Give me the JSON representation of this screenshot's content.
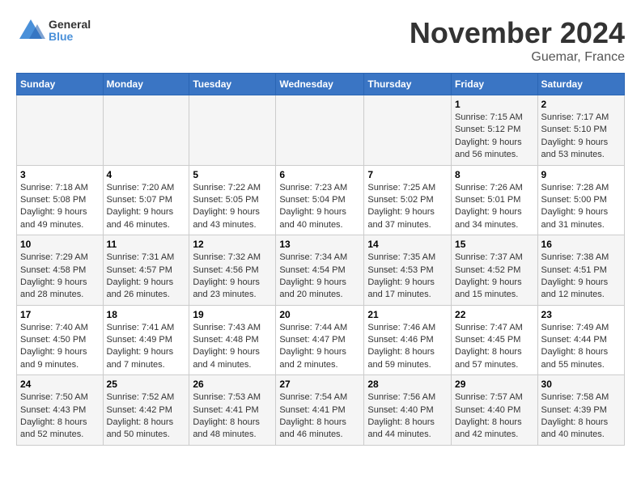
{
  "header": {
    "logo_general": "General",
    "logo_blue": "Blue",
    "month_title": "November 2024",
    "location": "Guemar, France"
  },
  "weekdays": [
    "Sunday",
    "Monday",
    "Tuesday",
    "Wednesday",
    "Thursday",
    "Friday",
    "Saturday"
  ],
  "weeks": [
    [
      {
        "day": "",
        "info": ""
      },
      {
        "day": "",
        "info": ""
      },
      {
        "day": "",
        "info": ""
      },
      {
        "day": "",
        "info": ""
      },
      {
        "day": "",
        "info": ""
      },
      {
        "day": "1",
        "info": "Sunrise: 7:15 AM\nSunset: 5:12 PM\nDaylight: 9 hours and 56 minutes."
      },
      {
        "day": "2",
        "info": "Sunrise: 7:17 AM\nSunset: 5:10 PM\nDaylight: 9 hours and 53 minutes."
      }
    ],
    [
      {
        "day": "3",
        "info": "Sunrise: 7:18 AM\nSunset: 5:08 PM\nDaylight: 9 hours and 49 minutes."
      },
      {
        "day": "4",
        "info": "Sunrise: 7:20 AM\nSunset: 5:07 PM\nDaylight: 9 hours and 46 minutes."
      },
      {
        "day": "5",
        "info": "Sunrise: 7:22 AM\nSunset: 5:05 PM\nDaylight: 9 hours and 43 minutes."
      },
      {
        "day": "6",
        "info": "Sunrise: 7:23 AM\nSunset: 5:04 PM\nDaylight: 9 hours and 40 minutes."
      },
      {
        "day": "7",
        "info": "Sunrise: 7:25 AM\nSunset: 5:02 PM\nDaylight: 9 hours and 37 minutes."
      },
      {
        "day": "8",
        "info": "Sunrise: 7:26 AM\nSunset: 5:01 PM\nDaylight: 9 hours and 34 minutes."
      },
      {
        "day": "9",
        "info": "Sunrise: 7:28 AM\nSunset: 5:00 PM\nDaylight: 9 hours and 31 minutes."
      }
    ],
    [
      {
        "day": "10",
        "info": "Sunrise: 7:29 AM\nSunset: 4:58 PM\nDaylight: 9 hours and 28 minutes."
      },
      {
        "day": "11",
        "info": "Sunrise: 7:31 AM\nSunset: 4:57 PM\nDaylight: 9 hours and 26 minutes."
      },
      {
        "day": "12",
        "info": "Sunrise: 7:32 AM\nSunset: 4:56 PM\nDaylight: 9 hours and 23 minutes."
      },
      {
        "day": "13",
        "info": "Sunrise: 7:34 AM\nSunset: 4:54 PM\nDaylight: 9 hours and 20 minutes."
      },
      {
        "day": "14",
        "info": "Sunrise: 7:35 AM\nSunset: 4:53 PM\nDaylight: 9 hours and 17 minutes."
      },
      {
        "day": "15",
        "info": "Sunrise: 7:37 AM\nSunset: 4:52 PM\nDaylight: 9 hours and 15 minutes."
      },
      {
        "day": "16",
        "info": "Sunrise: 7:38 AM\nSunset: 4:51 PM\nDaylight: 9 hours and 12 minutes."
      }
    ],
    [
      {
        "day": "17",
        "info": "Sunrise: 7:40 AM\nSunset: 4:50 PM\nDaylight: 9 hours and 9 minutes."
      },
      {
        "day": "18",
        "info": "Sunrise: 7:41 AM\nSunset: 4:49 PM\nDaylight: 9 hours and 7 minutes."
      },
      {
        "day": "19",
        "info": "Sunrise: 7:43 AM\nSunset: 4:48 PM\nDaylight: 9 hours and 4 minutes."
      },
      {
        "day": "20",
        "info": "Sunrise: 7:44 AM\nSunset: 4:47 PM\nDaylight: 9 hours and 2 minutes."
      },
      {
        "day": "21",
        "info": "Sunrise: 7:46 AM\nSunset: 4:46 PM\nDaylight: 8 hours and 59 minutes."
      },
      {
        "day": "22",
        "info": "Sunrise: 7:47 AM\nSunset: 4:45 PM\nDaylight: 8 hours and 57 minutes."
      },
      {
        "day": "23",
        "info": "Sunrise: 7:49 AM\nSunset: 4:44 PM\nDaylight: 8 hours and 55 minutes."
      }
    ],
    [
      {
        "day": "24",
        "info": "Sunrise: 7:50 AM\nSunset: 4:43 PM\nDaylight: 8 hours and 52 minutes."
      },
      {
        "day": "25",
        "info": "Sunrise: 7:52 AM\nSunset: 4:42 PM\nDaylight: 8 hours and 50 minutes."
      },
      {
        "day": "26",
        "info": "Sunrise: 7:53 AM\nSunset: 4:41 PM\nDaylight: 8 hours and 48 minutes."
      },
      {
        "day": "27",
        "info": "Sunrise: 7:54 AM\nSunset: 4:41 PM\nDaylight: 8 hours and 46 minutes."
      },
      {
        "day": "28",
        "info": "Sunrise: 7:56 AM\nSunset: 4:40 PM\nDaylight: 8 hours and 44 minutes."
      },
      {
        "day": "29",
        "info": "Sunrise: 7:57 AM\nSunset: 4:40 PM\nDaylight: 8 hours and 42 minutes."
      },
      {
        "day": "30",
        "info": "Sunrise: 7:58 AM\nSunset: 4:39 PM\nDaylight: 8 hours and 40 minutes."
      }
    ]
  ]
}
